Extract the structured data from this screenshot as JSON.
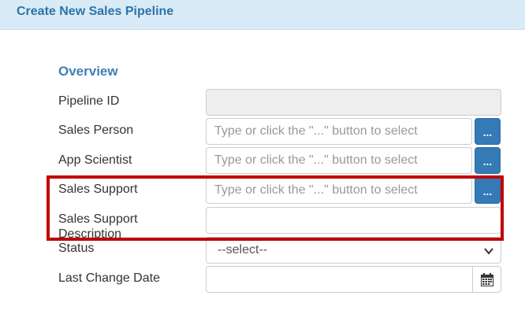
{
  "header": {
    "title": "Create New Sales Pipeline"
  },
  "section": {
    "title": "Overview"
  },
  "fields": {
    "pipeline_id": {
      "label": "Pipeline ID",
      "value": ""
    },
    "sales_person": {
      "label": "Sales Person",
      "placeholder": "Type or click the \"...\" button to select",
      "button_label": "..."
    },
    "app_scientist": {
      "label": "App Scientist",
      "placeholder": "Type or click the \"...\" button to select",
      "button_label": "..."
    },
    "sales_support": {
      "label": "Sales Support",
      "placeholder": "Type or click the \"...\" button to select",
      "button_label": "..."
    },
    "sales_support_description": {
      "label_line1": "Sales Support",
      "label_line2": "Description",
      "value": ""
    },
    "status": {
      "label": "Status",
      "selected": "--select--"
    },
    "last_change_date": {
      "label": "Last Change Date",
      "value": ""
    }
  },
  "colors": {
    "accent": "#337ab7",
    "highlight": "#c00000",
    "header_bg": "#d9ebf6"
  },
  "icons": {
    "status_dropdown": "chevron-down-icon",
    "date_picker": "calendar-icon"
  }
}
